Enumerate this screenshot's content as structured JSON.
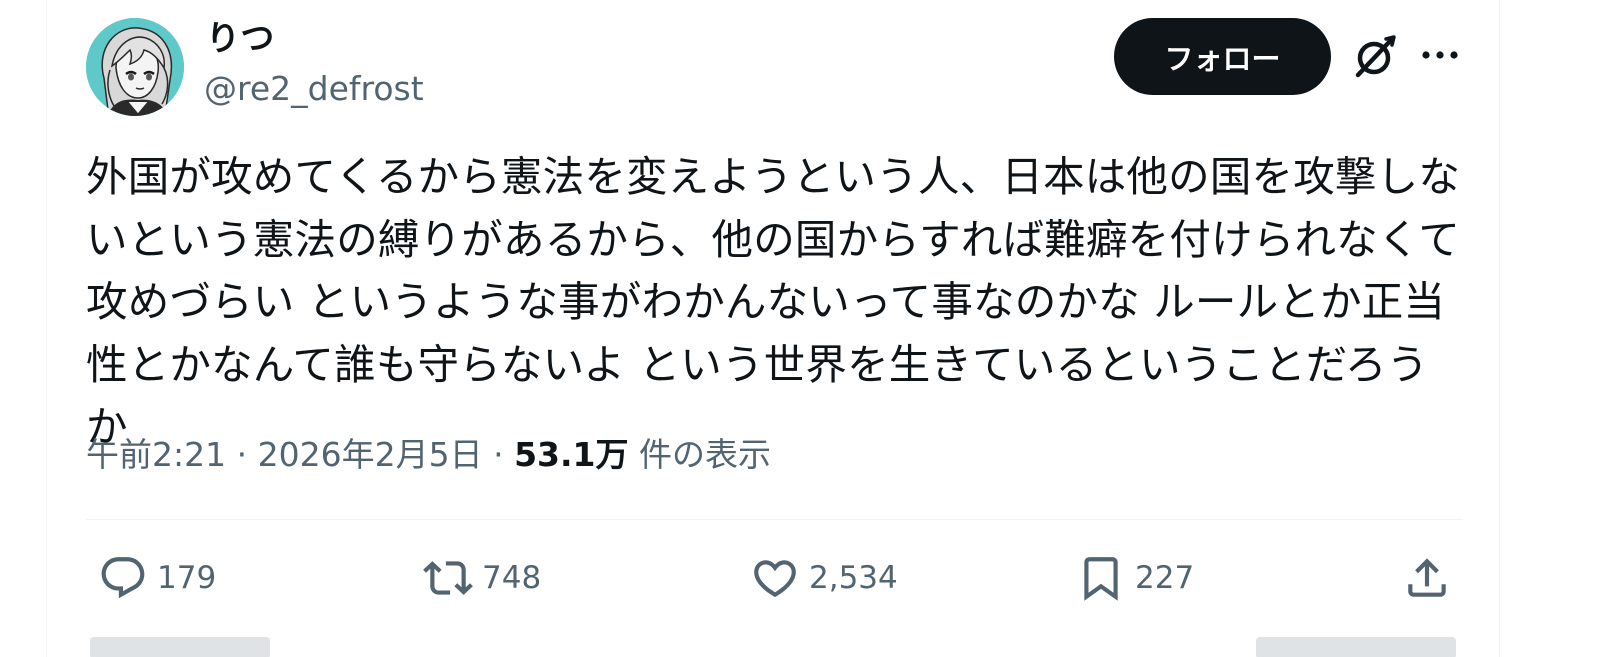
{
  "author": {
    "display_name": "りつ",
    "handle": "@re2_defrost",
    "avatar_icon": "anime-avatar-icon"
  },
  "header": {
    "follow_label": "フォロー",
    "grok_icon": "grok-icon",
    "more_icon": "more-icon"
  },
  "tweet": {
    "text": "外国が攻めてくるから憲法を変えようという人、日本は他の国を攻撃しないという憲法の縛りがあるから、他の国からすれば難癖を付けられなくて攻めづらい というような事がわかんないって事なのかな ルールとか正当性とかなんて誰も守らないよ という世界を生きているということだろうか"
  },
  "meta": {
    "time": "午前2:21",
    "separator": "·",
    "date": "2026年2月5日",
    "views_count": "53.1万",
    "views_label": "件の表示"
  },
  "actions": {
    "replies": "179",
    "reposts": "748",
    "likes": "2,534",
    "bookmarks": "227"
  },
  "colors": {
    "text_primary": "#0f1419",
    "text_secondary": "#536471",
    "follow_bg": "#0f1419",
    "divider": "#eff3f4",
    "avatar_bg": "#5fc9c9"
  }
}
